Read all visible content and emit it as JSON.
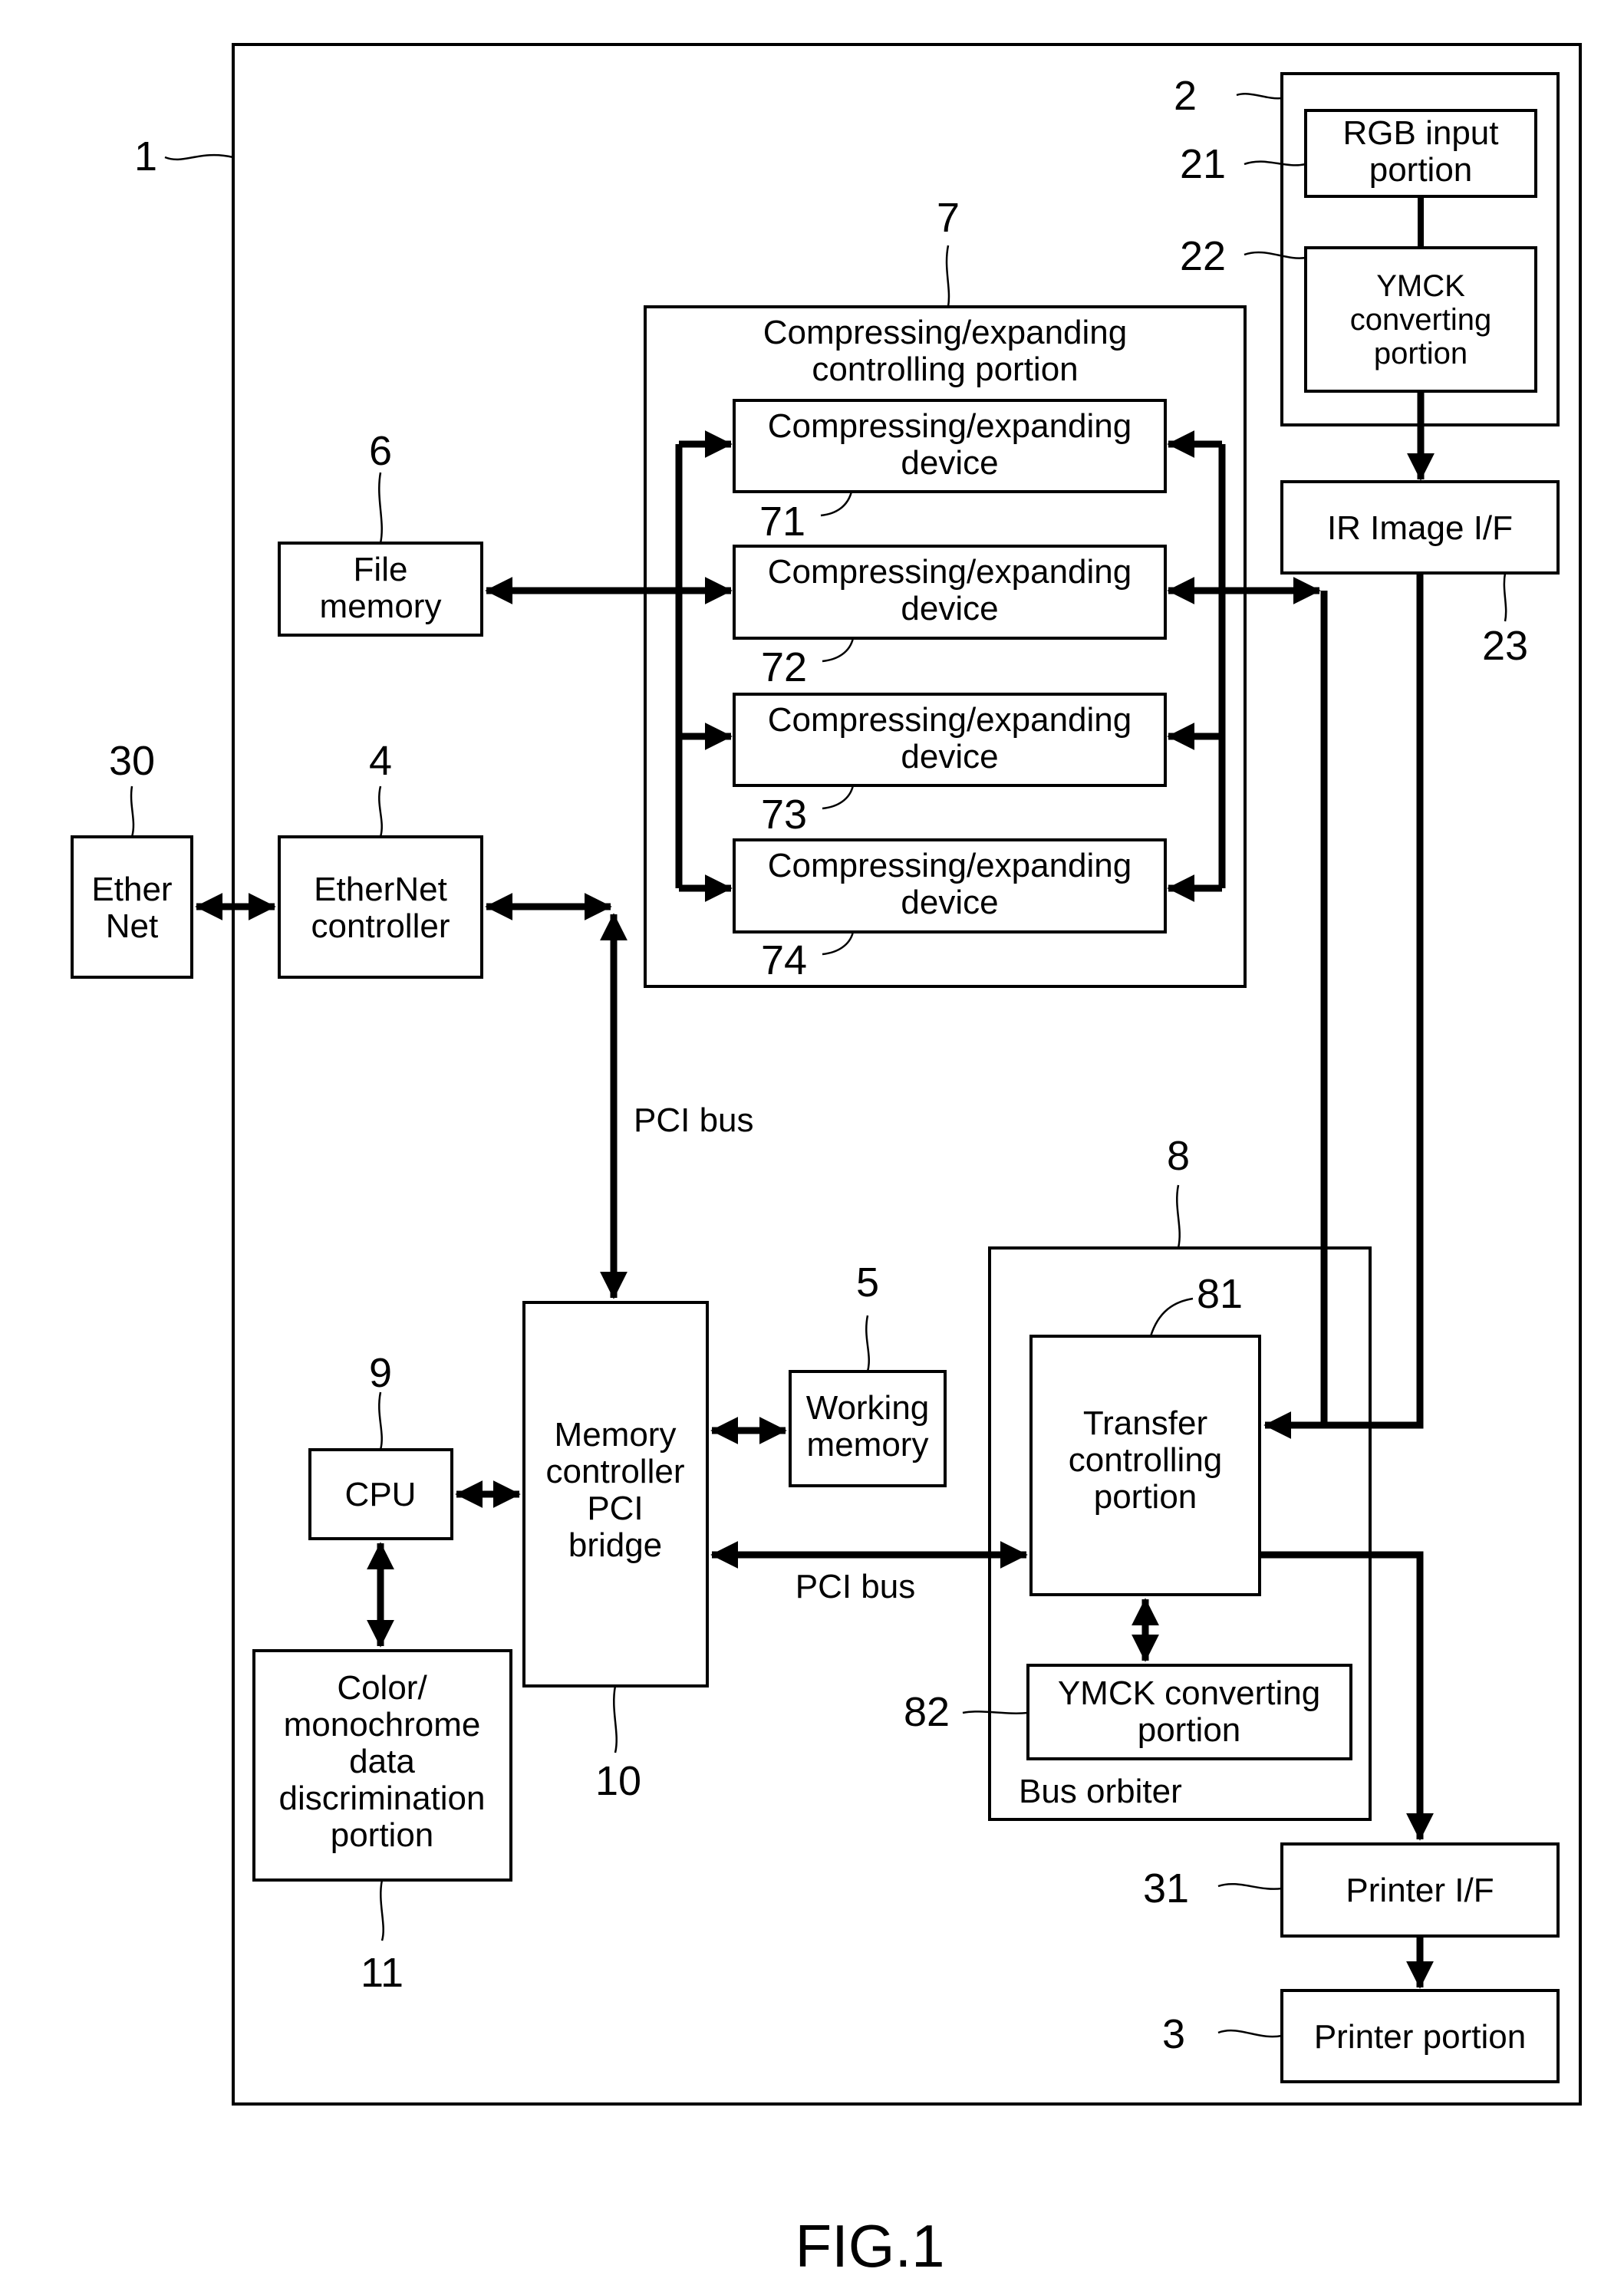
{
  "figure": {
    "title": "FIG.1",
    "accent_color": "#000000",
    "background": "#ffffff"
  },
  "refs": {
    "r1": "1",
    "r2": "2",
    "r21": "21",
    "r22": "22",
    "r23": "23",
    "r3": "3",
    "r31": "31",
    "r30": "30",
    "r4": "4",
    "r5": "5",
    "r6": "6",
    "r7": "7",
    "r71": "71",
    "r72": "72",
    "r73": "73",
    "r74": "74",
    "r8": "8",
    "r81": "81",
    "r82": "82",
    "r9": "9",
    "r10": "10",
    "r11": "11"
  },
  "blocks": {
    "rgb_input": [
      "RGB input",
      "portion"
    ],
    "ymck_converting_22": [
      "YMCK",
      "converting",
      "portion"
    ],
    "ir_image_if": [
      "IR Image I/F"
    ],
    "comp_ctrl": [
      "Compressing/expanding",
      "controlling portion"
    ],
    "comp_device": [
      "Compressing/expanding",
      "device"
    ],
    "file_memory": [
      "File",
      "memory"
    ],
    "ethernet": [
      "Ether",
      "Net"
    ],
    "ethernet_controller": [
      "EtherNet",
      "controller"
    ],
    "memory_controller": [
      "Memory",
      "controller",
      "PCI",
      "bridge"
    ],
    "working_memory": [
      "Working",
      "memory"
    ],
    "cpu": [
      "CPU"
    ],
    "color_mono": [
      "Color/",
      "monochrome",
      "data",
      "discrimination",
      "portion"
    ],
    "transfer_ctrl": [
      "Transfer",
      "controlling",
      "portion"
    ],
    "ymck_converting_82": [
      "YMCK converting",
      "portion"
    ],
    "bus_arbiter": [
      "Bus orbiter"
    ],
    "printer_if": [
      "Printer I/F"
    ],
    "printer_portion": [
      "Printer portion"
    ]
  },
  "bus_labels": {
    "pci_bus_vertical": "PCI bus",
    "pci_bus_horizontal": "PCI bus"
  }
}
